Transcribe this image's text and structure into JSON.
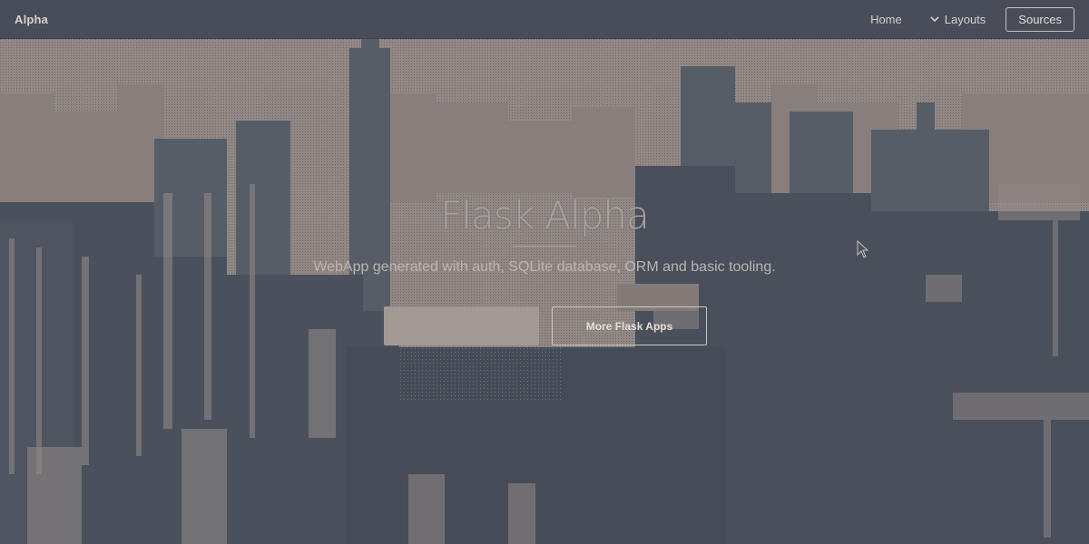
{
  "navbar": {
    "brand": "Alpha",
    "links": [
      {
        "label": "Home"
      },
      {
        "label": "Layouts",
        "icon": "chevron-down-icon"
      }
    ],
    "sources_label": "Sources"
  },
  "hero": {
    "title": "Flask Alpha",
    "subtitle": "WebApp generated with auth, SQLite database, ORM and basic tooling.",
    "primary_button": "",
    "secondary_button": "More Flask Apps"
  },
  "colors": {
    "background": "#484e5a",
    "navbar": "#484d59",
    "photo_light": "#9d928d",
    "photo_dark": "#4a505c"
  }
}
